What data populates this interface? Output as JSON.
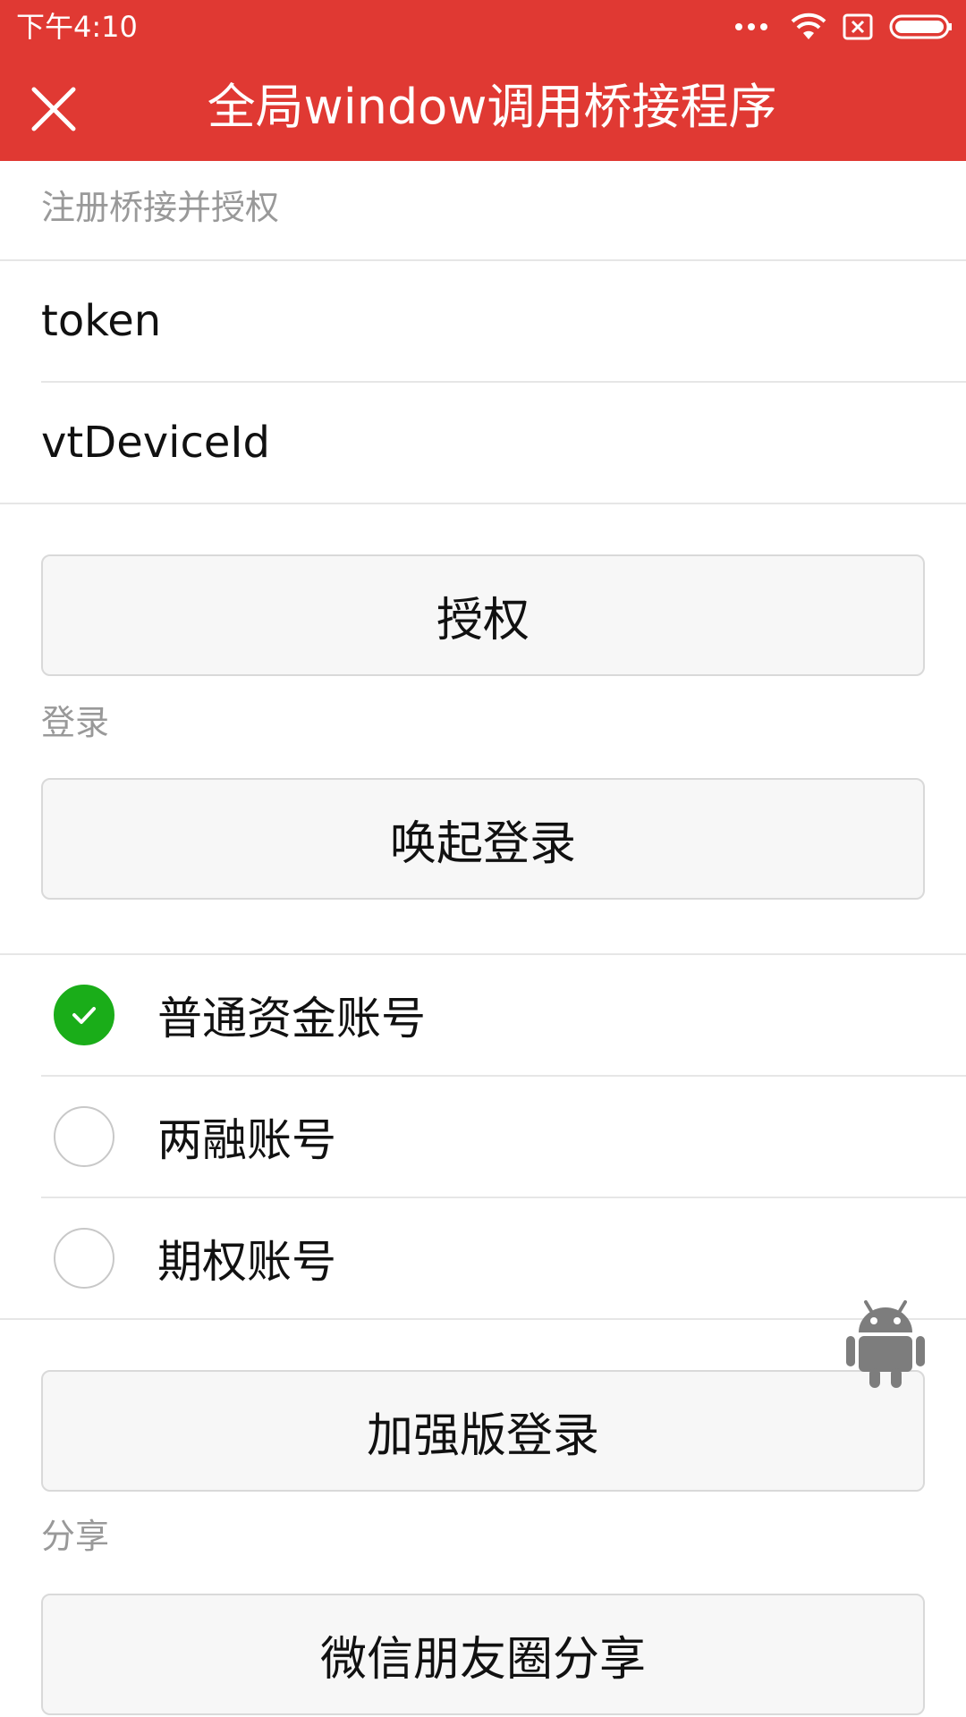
{
  "status_bar": {
    "time": "下午4:10"
  },
  "titlebar": {
    "title": "全局window调用桥接程序"
  },
  "sections": {
    "auth": {
      "label": "注册桥接并授权",
      "fields": [
        "token",
        "vtDeviceId"
      ],
      "button": "授权"
    },
    "login": {
      "label": "登录",
      "button": "唤起登录",
      "account_types": [
        {
          "label": "普通资金账号",
          "checked": true
        },
        {
          "label": "两融账号",
          "checked": false
        },
        {
          "label": "期权账号",
          "checked": false
        }
      ],
      "enhanced_button": "加强版登录"
    },
    "share": {
      "label": "分享",
      "button": "微信朋友圈分享"
    }
  },
  "colors": {
    "brand": "#e03933",
    "check": "#1aad19"
  }
}
